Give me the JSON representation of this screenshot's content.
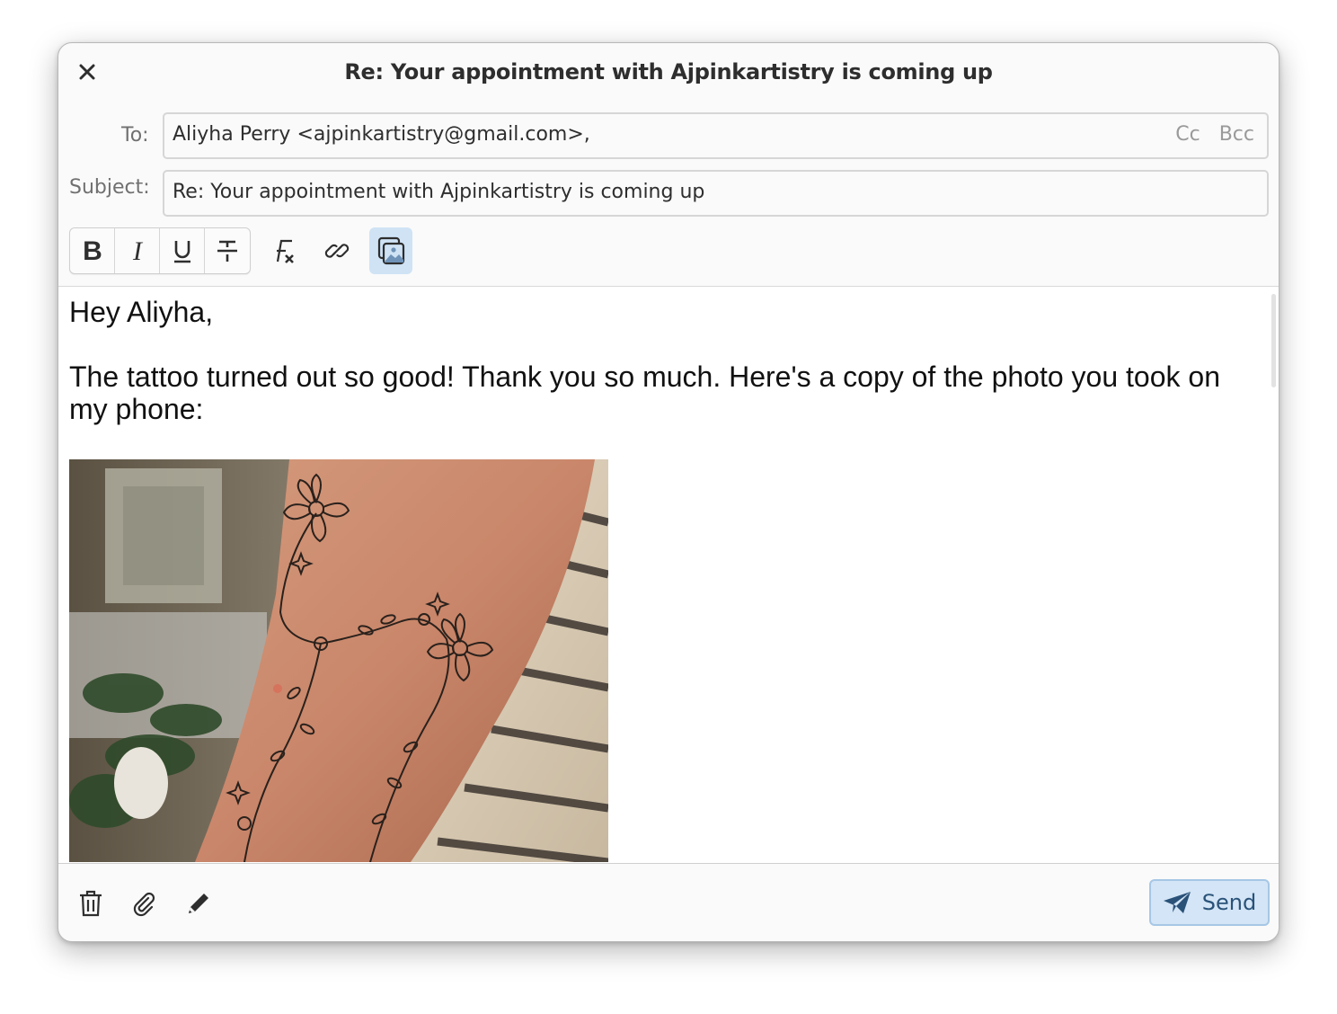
{
  "window": {
    "title": "Re: Your appointment with Ajpinkartistry is coming up",
    "close_icon": "close-icon"
  },
  "compose": {
    "to_label": "To:",
    "to_value": "Aliyha Perry <ajpinkartistry@gmail.com>,",
    "cc_label": "Cc",
    "bcc_label": "Bcc",
    "subject_label": "Subject:",
    "subject_value": "Re: Your appointment with Ajpinkartistry is coming up"
  },
  "toolbar": {
    "bold_icon": "bold-icon",
    "italic_icon": "italic-icon",
    "underline_icon": "underline-icon",
    "strikethrough_icon": "strikethrough-icon",
    "clear_format_icon": "clear-formatting-icon",
    "link_icon": "insert-link-icon",
    "image_icon": "insert-image-icon",
    "image_active": true
  },
  "message": {
    "greeting": "Hey Aliyha,",
    "paragraph": "The tattoo turned out so good! Thank you so much. Here's a copy of the photo you took on my phone:"
  },
  "footer": {
    "delete_icon": "trash-icon",
    "attach_icon": "paperclip-icon",
    "edit_icon": "pencil-icon",
    "send_label": "Send",
    "send_icon": "paper-plane-icon"
  },
  "colors": {
    "accent": "#d3e5f6",
    "accent_text": "#2a5279",
    "active_tool": "#cfe3f5"
  }
}
